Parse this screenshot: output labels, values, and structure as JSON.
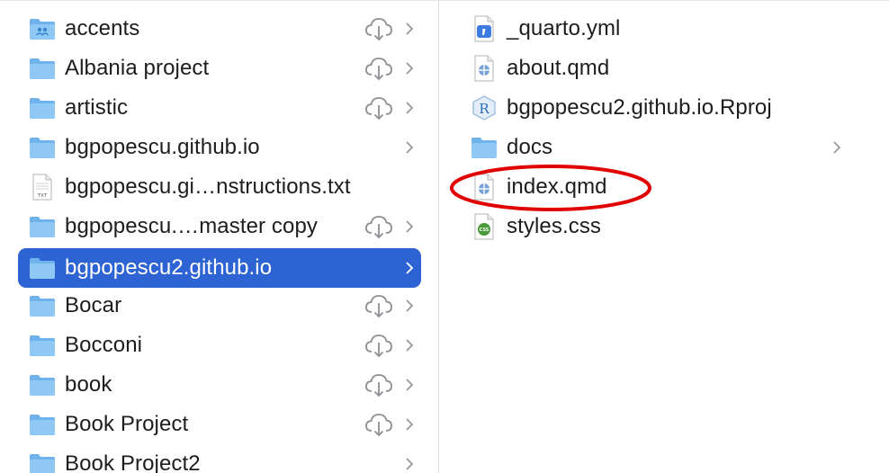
{
  "left_column": {
    "items": [
      {
        "name": "accents",
        "type": "folder-shared",
        "icloud": true,
        "chevron": true,
        "selected": false
      },
      {
        "name": "Albania project",
        "type": "folder",
        "icloud": true,
        "chevron": true,
        "selected": false
      },
      {
        "name": "artistic",
        "type": "folder",
        "icloud": true,
        "chevron": true,
        "selected": false
      },
      {
        "name": "bgpopescu.github.io",
        "type": "folder",
        "icloud": false,
        "chevron": true,
        "selected": false
      },
      {
        "name": "bgpopescu.gi…nstructions.txt",
        "type": "txt",
        "icloud": false,
        "chevron": false,
        "selected": false
      },
      {
        "name": "bgpopescu.…master copy",
        "type": "folder",
        "icloud": true,
        "chevron": true,
        "selected": false
      },
      {
        "name": "bgpopescu2.github.io",
        "type": "folder",
        "icloud": false,
        "chevron": true,
        "selected": true
      },
      {
        "name": "Bocar",
        "type": "folder",
        "icloud": true,
        "chevron": true,
        "selected": false
      },
      {
        "name": "Bocconi",
        "type": "folder",
        "icloud": true,
        "chevron": true,
        "selected": false
      },
      {
        "name": "book",
        "type": "folder",
        "icloud": true,
        "chevron": true,
        "selected": false
      },
      {
        "name": "Book Project",
        "type": "folder",
        "icloud": true,
        "chevron": true,
        "selected": false
      },
      {
        "name": "Book Project2",
        "type": "folder",
        "icloud": false,
        "chevron": true,
        "selected": false
      }
    ]
  },
  "right_column": {
    "items": [
      {
        "name": "_quarto.yml",
        "type": "yml",
        "chevron": false
      },
      {
        "name": "about.qmd",
        "type": "qmd",
        "chevron": false
      },
      {
        "name": "bgpopescu2.github.io.Rproj",
        "type": "rproj",
        "chevron": false
      },
      {
        "name": "docs",
        "type": "folder",
        "chevron": true
      },
      {
        "name": "index.qmd",
        "type": "qmd",
        "chevron": false,
        "circled": true
      },
      {
        "name": "styles.css",
        "type": "css",
        "chevron": false
      }
    ]
  },
  "colors": {
    "selection": "#2e63d3",
    "folder": "#7cbdf0",
    "annotation": "#e00000"
  },
  "icons": {
    "txt_badge": "TXT",
    "rproj_badge": "R",
    "css_badge": "CSS"
  }
}
